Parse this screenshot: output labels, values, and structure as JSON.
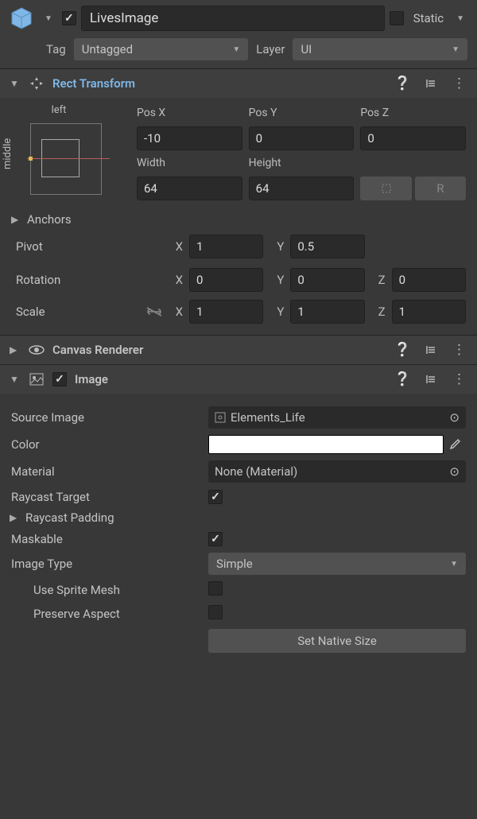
{
  "header": {
    "name": "LivesImage",
    "static_label": "Static",
    "tag_label": "Tag",
    "tag_value": "Untagged",
    "layer_label": "Layer",
    "layer_value": "UI"
  },
  "rect_transform": {
    "title": "Rect Transform",
    "anchor_h": "left",
    "anchor_v": "middle",
    "posx_label": "Pos X",
    "posx": "-10",
    "posy_label": "Pos Y",
    "posy": "0",
    "posz_label": "Pos Z",
    "posz": "0",
    "width_label": "Width",
    "width": "64",
    "height_label": "Height",
    "height": "64",
    "anchors_label": "Anchors",
    "pivot_label": "Pivot",
    "pivot_x": "1",
    "pivot_y": "0.5",
    "rotation_label": "Rotation",
    "rot_x": "0",
    "rot_y": "0",
    "rot_z": "0",
    "scale_label": "Scale",
    "scale_x": "1",
    "scale_y": "1",
    "scale_z": "1",
    "x": "X",
    "y": "Y",
    "z": "Z"
  },
  "canvas_renderer": {
    "title": "Canvas Renderer"
  },
  "image": {
    "title": "Image",
    "source_image_label": "Source Image",
    "source_image_value": "Elements_Life",
    "color_label": "Color",
    "color_value": "#FFFFFF",
    "material_label": "Material",
    "material_value": "None (Material)",
    "raycast_target_label": "Raycast Target",
    "raycast_padding_label": "Raycast Padding",
    "maskable_label": "Maskable",
    "image_type_label": "Image Type",
    "image_type_value": "Simple",
    "use_sprite_mesh_label": "Use Sprite Mesh",
    "preserve_aspect_label": "Preserve Aspect",
    "set_native_size_label": "Set Native Size"
  }
}
